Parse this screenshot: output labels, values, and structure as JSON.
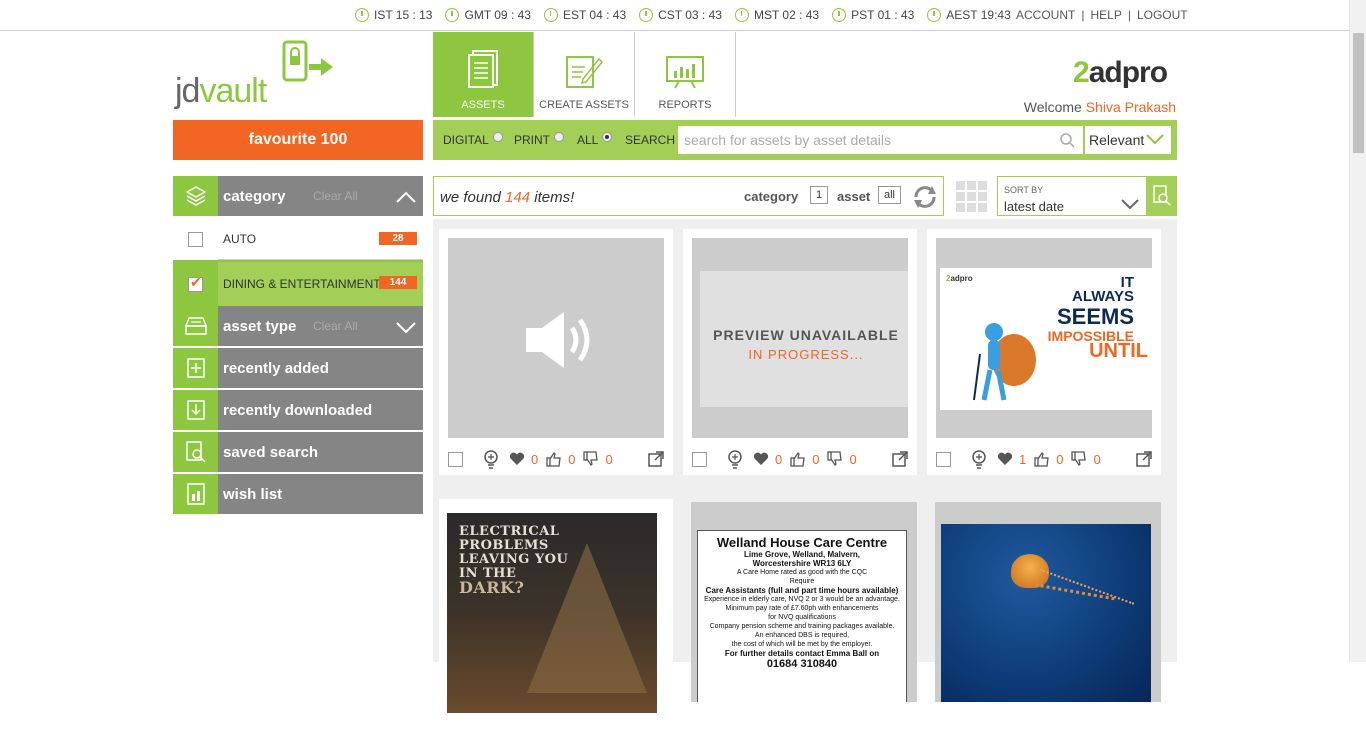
{
  "topbar": {
    "clocks": [
      "IST 15 : 13",
      "GMT 09 : 43",
      "EST 04 : 43",
      "CST 03 : 43",
      "MST 02 : 43",
      "PST 01 : 43",
      "AEST 19:43"
    ],
    "account": "ACCOUNT",
    "help": "HELP",
    "logout": "LOGOUT",
    "sep": "|"
  },
  "logo": {
    "a": "jd",
    "b": "vault"
  },
  "nav": {
    "tabs": [
      {
        "label": "ASSETS"
      },
      {
        "label": "CREATE ASSETS"
      },
      {
        "label": "REPORTS"
      }
    ]
  },
  "brand": {
    "a": "2",
    "b": "adpro"
  },
  "welcome": {
    "prefix": "Welcome ",
    "user": "Shiva Prakash"
  },
  "favourite": {
    "label": "favourite 100"
  },
  "search": {
    "digital": "DIGITAL",
    "print": "PRINT",
    "all": "ALL",
    "search": "SEARCH",
    "placeholder": "search for assets by asset details",
    "sort": "Relevant"
  },
  "sidebar": {
    "category": {
      "label": "category",
      "clear": "Clear All"
    },
    "items": [
      {
        "name": "AUTO",
        "count": "28"
      },
      {
        "name": "DINING & ENTERTAINMENT",
        "count": "144"
      }
    ],
    "asset_type": {
      "label": "asset type",
      "clear": "Clear All"
    },
    "recently_added": "recently added",
    "recently_downloaded": "recently downloaded",
    "saved_search": "saved search",
    "wish_list": "wish list"
  },
  "results": {
    "prefix": "we found ",
    "count": "144",
    "suffix": " items!",
    "category_label": "category",
    "category_value": "1",
    "asset_label": "asset",
    "asset_value": "all"
  },
  "sort": {
    "label": "SORT BY",
    "value": "latest date"
  },
  "cards": [
    {
      "likes": "0",
      "up": "0",
      "down": "0"
    },
    {
      "likes": "0",
      "up": "0",
      "down": "0",
      "preview1": "PREVIEW UNAVAILABLE",
      "preview2": "IN PROGRESS..."
    },
    {
      "likes": "1",
      "up": "0",
      "down": "0",
      "ad_mini_a": "2",
      "ad_mini_b": "adpro",
      "ad_l1": "IT",
      "ad_l1b": "ALWAYS",
      "ad_l2": "SEEMS",
      "ad_l3": "IMPOSSIBLE",
      "ad_l4": "UNTIL"
    }
  ],
  "electrical": {
    "lines": [
      "ELECTRICAL",
      "PROBLEMS",
      "LEAVING YOU",
      "IN THE",
      "DARK?"
    ]
  },
  "welland": {
    "title": "Welland House Care Centre",
    "addr1": "Lime Grove, Welland, Malvern,",
    "addr2": "Worcestershire WR13 6LY",
    "l1": "A Care Home rated as good with the CQC",
    "l2": "Require",
    "l3": "Care Assistants (full and part time hours available)",
    "l4": "Experience in elderly care, NVQ 2 or 3 would be an advantage.",
    "l5": "Minimum pay rate of £7.60ph with enhancements",
    "l6": "for NVQ qualifications",
    "l7": "Company pension scheme and training packages available.",
    "l8": "An enhanced DBS is required,",
    "l9": "the cost of which will be met by the employer.",
    "l10": "For further details contact Emma Ball on",
    "l11": "01684 310840"
  },
  "colors": {
    "green": "#8dc63f",
    "light_green": "#a4cf57",
    "orange": "#f26522",
    "grey": "#858585"
  }
}
